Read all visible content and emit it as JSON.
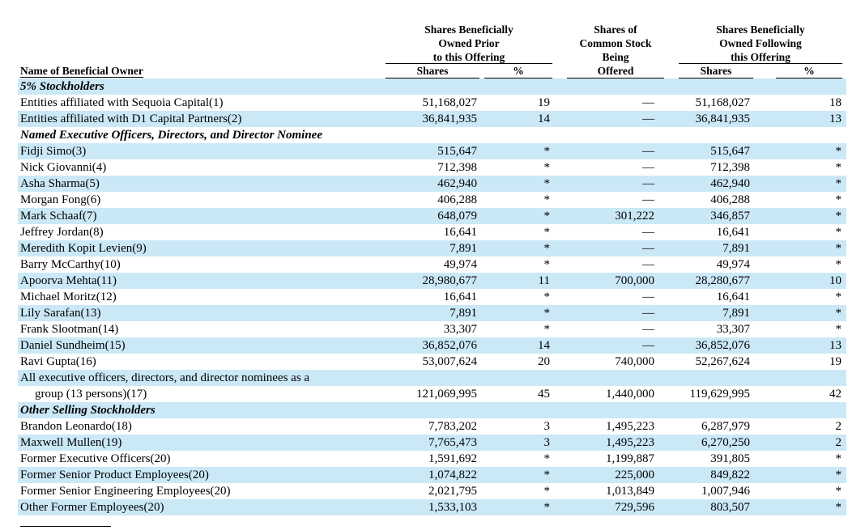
{
  "headers": {
    "group_prior": [
      "Shares Beneficially",
      "Owned Prior",
      "to this Offering"
    ],
    "group_offered": [
      "Shares of",
      "Common Stock",
      "Being",
      "Offered"
    ],
    "group_following": [
      "Shares Beneficially",
      "Owned Following",
      "this Offering"
    ],
    "name_col": "Name of Beneficial Owner",
    "shares_prior": "Shares",
    "pct_prior": "%",
    "shares_following": "Shares",
    "pct_following": "%"
  },
  "rows": [
    {
      "type": "section",
      "name": "5% Stockholders"
    },
    {
      "type": "data",
      "name": "Entities affiliated with Sequoia Capital(1)",
      "shares_prior": "51,168,027",
      "pct_prior": "19",
      "offered": "—",
      "shares_after": "51,168,027",
      "pct_after": "18"
    },
    {
      "type": "data",
      "name": "Entities affiliated with D1 Capital Partners(2)",
      "shares_prior": "36,841,935",
      "pct_prior": "14",
      "offered": "—",
      "shares_after": "36,841,935",
      "pct_after": "13"
    },
    {
      "type": "section",
      "name": "Named Executive Officers, Directors, and Director Nominee"
    },
    {
      "type": "data",
      "name": "Fidji Simo(3)",
      "shares_prior": "515,647",
      "pct_prior": "*",
      "offered": "—",
      "shares_after": "515,647",
      "pct_after": "*"
    },
    {
      "type": "data",
      "name": "Nick Giovanni(4)",
      "shares_prior": "712,398",
      "pct_prior": "*",
      "offered": "—",
      "shares_after": "712,398",
      "pct_after": "*"
    },
    {
      "type": "data",
      "name": "Asha Sharma(5)",
      "shares_prior": "462,940",
      "pct_prior": "*",
      "offered": "—",
      "shares_after": "462,940",
      "pct_after": "*"
    },
    {
      "type": "data",
      "name": "Morgan Fong(6)",
      "shares_prior": "406,288",
      "pct_prior": "*",
      "offered": "—",
      "shares_after": "406,288",
      "pct_after": "*"
    },
    {
      "type": "data",
      "name": "Mark Schaaf(7)",
      "shares_prior": "648,079",
      "pct_prior": "*",
      "offered": "301,222",
      "shares_after": "346,857",
      "pct_after": "*"
    },
    {
      "type": "data",
      "name": "Jeffrey Jordan(8)",
      "shares_prior": "16,641",
      "pct_prior": "*",
      "offered": "—",
      "shares_after": "16,641",
      "pct_after": "*"
    },
    {
      "type": "data",
      "name": "Meredith Kopit Levien(9)",
      "shares_prior": "7,891",
      "pct_prior": "*",
      "offered": "—",
      "shares_after": "7,891",
      "pct_after": "*"
    },
    {
      "type": "data",
      "name": "Barry McCarthy(10)",
      "shares_prior": "49,974",
      "pct_prior": "*",
      "offered": "—",
      "shares_after": "49,974",
      "pct_after": "*"
    },
    {
      "type": "data",
      "name": "Apoorva Mehta(11)",
      "shares_prior": "28,980,677",
      "pct_prior": "11",
      "offered": "700,000",
      "shares_after": "28,280,677",
      "pct_after": "10"
    },
    {
      "type": "data",
      "name": "Michael Moritz(12)",
      "shares_prior": "16,641",
      "pct_prior": "*",
      "offered": "—",
      "shares_after": "16,641",
      "pct_after": "*"
    },
    {
      "type": "data",
      "name": "Lily Sarafan(13)",
      "shares_prior": "7,891",
      "pct_prior": "*",
      "offered": "—",
      "shares_after": "7,891",
      "pct_after": "*"
    },
    {
      "type": "data",
      "name": "Frank Slootman(14)",
      "shares_prior": "33,307",
      "pct_prior": "*",
      "offered": "—",
      "shares_after": "33,307",
      "pct_after": "*"
    },
    {
      "type": "data",
      "name": "Daniel Sundheim(15)",
      "shares_prior": "36,852,076",
      "pct_prior": "14",
      "offered": "—",
      "shares_after": "36,852,076",
      "pct_after": "13"
    },
    {
      "type": "data",
      "name": "Ravi Gupta(16)",
      "shares_prior": "53,007,624",
      "pct_prior": "20",
      "offered": "740,000",
      "shares_after": "52,267,624",
      "pct_after": "19"
    },
    {
      "type": "text",
      "name": "All executive officers, directors, and director nominees as a"
    },
    {
      "type": "data",
      "indent": true,
      "name": "group (13 persons)(17)",
      "shares_prior": "121,069,995",
      "pct_prior": "45",
      "offered": "1,440,000",
      "shares_after": "119,629,995",
      "pct_after": "42"
    },
    {
      "type": "section",
      "name": "Other Selling Stockholders"
    },
    {
      "type": "data",
      "name": "Brandon Leonardo(18)",
      "shares_prior": "7,783,202",
      "pct_prior": "3",
      "offered": "1,495,223",
      "shares_after": "6,287,979",
      "pct_after": "2"
    },
    {
      "type": "data",
      "name": "Maxwell Mullen(19)",
      "shares_prior": "7,765,473",
      "pct_prior": "3",
      "offered": "1,495,223",
      "shares_after": "6,270,250",
      "pct_after": "2"
    },
    {
      "type": "data",
      "name": "Former Executive Officers(20)",
      "shares_prior": "1,591,692",
      "pct_prior": "*",
      "offered": "1,199,887",
      "shares_after": "391,805",
      "pct_after": "*"
    },
    {
      "type": "data",
      "name": "Former Senior Product Employees(20)",
      "shares_prior": "1,074,822",
      "pct_prior": "*",
      "offered": "225,000",
      "shares_after": "849,822",
      "pct_after": "*"
    },
    {
      "type": "data",
      "name": "Former Senior Engineering Employees(20)",
      "shares_prior": "2,021,795",
      "pct_prior": "*",
      "offered": "1,013,849",
      "shares_after": "1,007,946",
      "pct_after": "*"
    },
    {
      "type": "data",
      "name": "Other Former Employees(20)",
      "shares_prior": "1,533,103",
      "pct_prior": "*",
      "offered": "729,596",
      "shares_after": "803,507",
      "pct_after": "*"
    }
  ]
}
